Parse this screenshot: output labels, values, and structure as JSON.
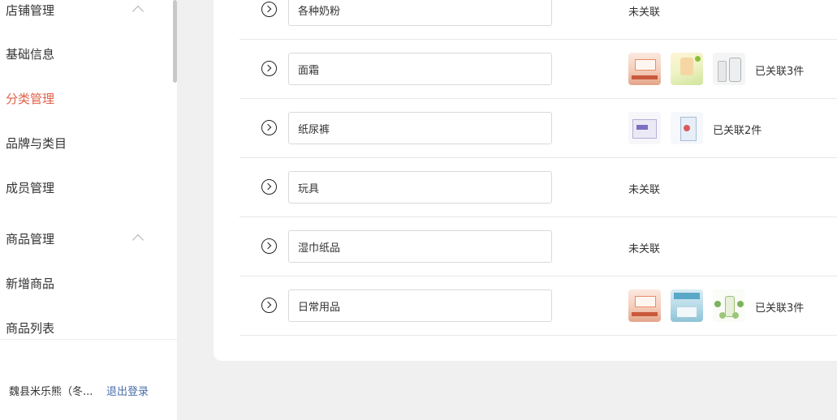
{
  "sidebar": {
    "groups": [
      {
        "title": "店铺管理",
        "items": [
          "基础信息",
          "分类管理",
          "品牌与类目",
          "成员管理"
        ]
      },
      {
        "title": "商品管理",
        "items": [
          "新增商品",
          "商品列表"
        ]
      }
    ],
    "active_item": "分类管理",
    "user_name": "魏县米乐熊（冬...",
    "logout_label": "退出登录"
  },
  "categories": [
    {
      "name": "各种奶粉",
      "status": "未关联",
      "linked_count": 0
    },
    {
      "name": "面霜",
      "status": "已关联3件",
      "linked_count": 3,
      "thumbnails": [
        "product-box-icon",
        "product-box-icon",
        "bottles-icon"
      ]
    },
    {
      "name": "纸尿裤",
      "status": "已关联2件",
      "linked_count": 2,
      "thumbnails": [
        "diaper-pack-icon",
        "diaper-pack-icon"
      ]
    },
    {
      "name": "玩具",
      "status": "未关联",
      "linked_count": 0
    },
    {
      "name": "湿巾纸品",
      "status": "未关联",
      "linked_count": 0
    },
    {
      "name": "日常用品",
      "status": "已关联3件",
      "linked_count": 3,
      "thumbnails": [
        "product-box-icon",
        "store-shelf-icon",
        "product-circle-icon"
      ]
    }
  ],
  "colors": {
    "active": "#e0604a",
    "link": "#4a6ea8",
    "text": "#333333",
    "page_bg": "#f0f0f0"
  }
}
